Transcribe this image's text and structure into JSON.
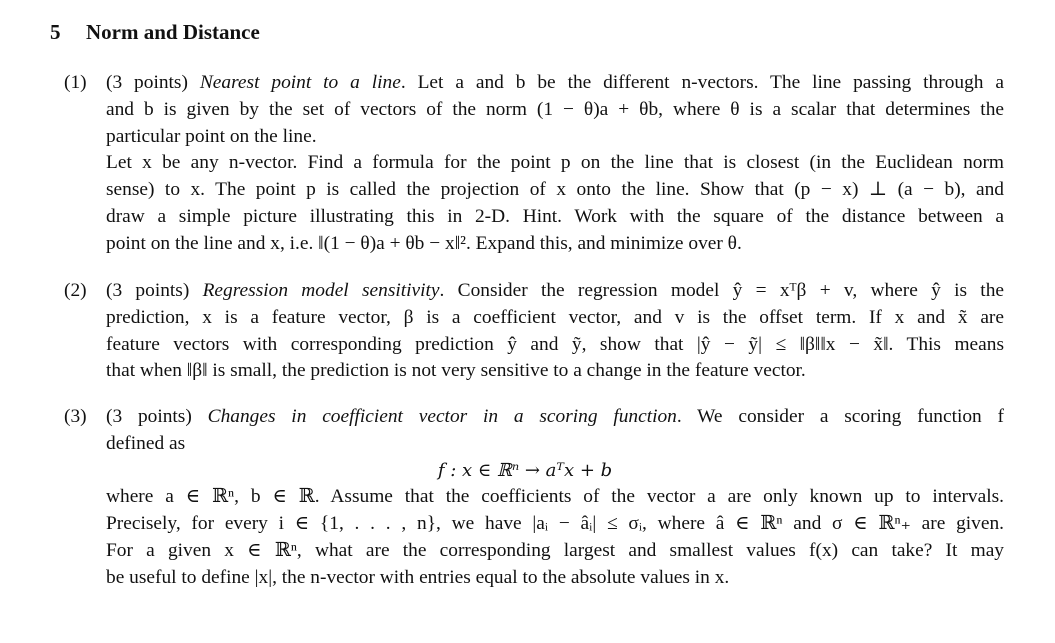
{
  "section": {
    "number": "5",
    "title": "Norm and Distance"
  },
  "problems": [
    {
      "label": "(1)",
      "points": "(3 points)",
      "topic": "Nearest point to a line",
      "lines": [
        ". Let a and b be the different n-vectors. The line passing through a",
        "and b is given by the set of vectors of the norm (1 − θ)a + θb, where θ is a scalar that determines the",
        "particular point on the line.",
        "Let x be any n-vector. Find a formula for the point p on the line that is closest (in the Euclidean norm",
        "sense) to x. The point p is called the projection of x onto the line. Show that (p − x) ⊥ (a − b), and",
        "draw a simple picture illustrating this in 2-D. Hint. Work with the square of the distance between a",
        "point on the line and x, i.e. ‖(1 − θ)a + θb − x‖². Expand this, and minimize over θ."
      ]
    },
    {
      "label": "(2)",
      "points": "(3 points)",
      "topic": "Regression model sensitivity",
      "lines": [
        ". Consider the regression model ŷ = xᵀβ + v, where ŷ is the",
        "prediction, x is a feature vector, β is a coefficient vector, and v is the offset term. If x and x̃ are",
        "feature vectors with corresponding prediction ŷ and ỹ, show that |ŷ − ỹ| ≤ ‖β‖‖x − x̃‖. This means",
        "that when ‖β‖ is small, the prediction is not very sensitive to a change in the feature vector."
      ]
    },
    {
      "label": "(3)",
      "points": "(3 points)",
      "topic": "Changes in coefficient vector in a scoring function",
      "lines": [
        ". We consider a scoring function f",
        "defined as"
      ],
      "display_equation": "f : x ∈ ℝⁿ → aᵀx + b",
      "lines_after": [
        "where a ∈ ℝⁿ, b ∈ ℝ. Assume that the coefficients of the vector a are only known up to intervals.",
        "Precisely, for every i ∈ {1, . . . , n}, we have |aᵢ − âᵢ| ≤ σᵢ, where â ∈ ℝⁿ and σ ∈ ℝⁿ₊ are given.",
        "For a given x ∈ ℝⁿ, what are the corresponding largest and smallest values f(x) can take? It may",
        "be useful to define |x|, the n-vector with entries equal to the absolute values in x."
      ]
    }
  ]
}
